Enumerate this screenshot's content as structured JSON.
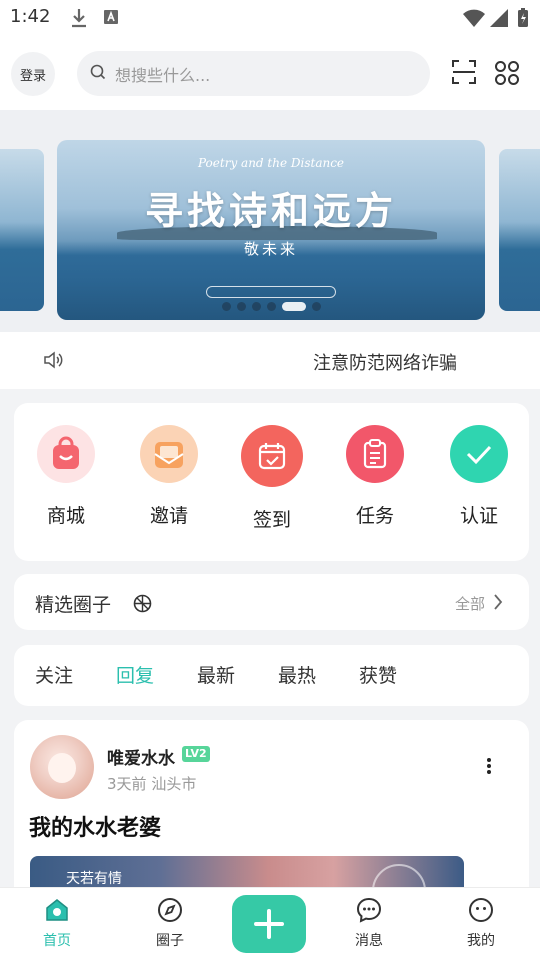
{
  "status_bar": {
    "time": "1:42",
    "icons": [
      "download-icon",
      "a-notification-icon",
      "wifi-icon",
      "signal-icon",
      "battery-icon"
    ]
  },
  "header": {
    "login_label": "登录",
    "search_placeholder": "想搜些什么...",
    "icons": [
      "search-icon",
      "scan-icon",
      "apps-icon"
    ]
  },
  "banner": {
    "script_text": "Poetry and the Distance",
    "title": "寻找诗和远方",
    "subtitle": "敬未来",
    "page_count": 6,
    "active_page": 5
  },
  "notice": {
    "icon": "speaker-icon",
    "text": "注意防范网络诈骗"
  },
  "quick_actions": [
    {
      "label": "商城",
      "icon": "shopping-bag-icon",
      "color": "#f4666f"
    },
    {
      "label": "邀请",
      "icon": "envelope-icon",
      "color": "#f7a25f"
    },
    {
      "label": "签到",
      "icon": "calendar-check-icon",
      "color": "#f3655e"
    },
    {
      "label": "任务",
      "icon": "clipboard-icon",
      "color": "#f2576a"
    },
    {
      "label": "认证",
      "icon": "checkmark-icon",
      "color": "#2fd5b0"
    }
  ],
  "featured_circles": {
    "title": "精选圈子",
    "title_icon": "aperture-icon",
    "all_label": "全部"
  },
  "feed_tabs": {
    "items": [
      "关注",
      "回复",
      "最新",
      "最热",
      "获赞"
    ],
    "active": "回复"
  },
  "post": {
    "username": "唯爱水水",
    "level": "LV2",
    "time": "3天前",
    "location": "汕头市",
    "title": "我的水水老婆",
    "image_caption": "天若有情"
  },
  "bottom_nav": {
    "items": [
      {
        "label": "首页",
        "icon": "home-icon",
        "active": true
      },
      {
        "label": "圈子",
        "icon": "compass-icon",
        "active": false
      },
      {
        "label": "",
        "icon": "plus-icon",
        "active": false
      },
      {
        "label": "消息",
        "icon": "chat-icon",
        "active": false
      },
      {
        "label": "我的",
        "icon": "profile-face-icon",
        "active": false
      }
    ]
  },
  "colors": {
    "accent": "#2bbfae",
    "publish_button": "#36c9a6",
    "page_background": "#f2f3f5"
  }
}
